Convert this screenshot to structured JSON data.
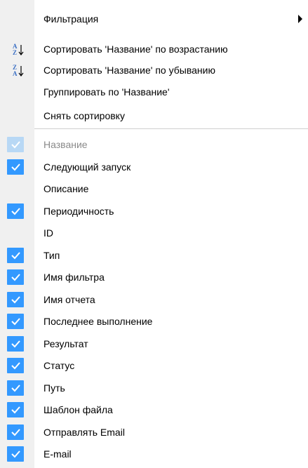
{
  "menu": {
    "filter_label": "Фильтрация",
    "sort_asc_label": "Сортировать 'Название' по возрастанию",
    "sort_desc_label": "Сортировать 'Название' по убыванию",
    "group_label": "Группировать по 'Название'",
    "clear_sort_label": "Снять сортировку",
    "icons": {
      "sort_asc": "sort-ascending-az-icon",
      "sort_desc": "sort-descending-za-icon",
      "submenu": "submenu-arrow-icon",
      "check": "checkmark-icon"
    },
    "colors": {
      "check_bg": "#3399ff",
      "check_bg_disabled": "#b8d8f5",
      "gutter": "#f0f0f0",
      "disabled_text": "#8a8a8a"
    },
    "columns": [
      {
        "label": "Название",
        "checked": true,
        "disabled": true
      },
      {
        "label": "Следующий запуск",
        "checked": true
      },
      {
        "label": "Описание",
        "checked": false
      },
      {
        "label": "Периодичность",
        "checked": true
      },
      {
        "label": "ID",
        "checked": false
      },
      {
        "label": "Тип",
        "checked": true
      },
      {
        "label": "Имя фильтра",
        "checked": true
      },
      {
        "label": "Имя отчета",
        "checked": true
      },
      {
        "label": "Последнее выполнение",
        "checked": true
      },
      {
        "label": "Результат",
        "checked": true
      },
      {
        "label": "Статус",
        "checked": true
      },
      {
        "label": "Путь",
        "checked": true
      },
      {
        "label": "Шаблон файла",
        "checked": true
      },
      {
        "label": "Отправлять Email",
        "checked": true
      },
      {
        "label": "E-mail",
        "checked": true
      }
    ]
  }
}
